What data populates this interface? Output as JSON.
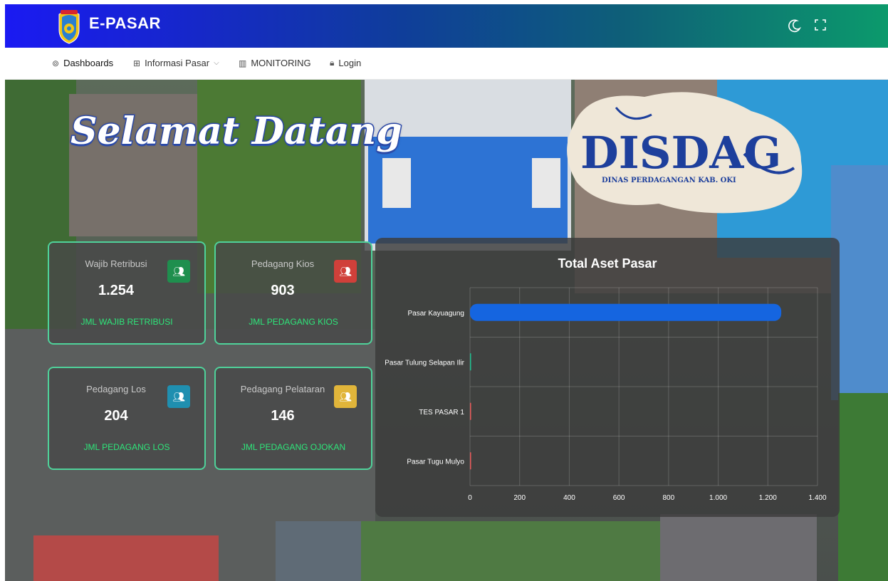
{
  "app": {
    "brand": "E-PASAR"
  },
  "nav": {
    "items": [
      {
        "label": "Dashboards",
        "icon": "dashboard-icon"
      },
      {
        "label": "Informasi Pasar",
        "icon": "grid-icon",
        "has_dropdown": true
      },
      {
        "label": "MONITORING",
        "icon": "bar-chart-icon"
      },
      {
        "label": "Login",
        "icon": "lock-icon"
      }
    ]
  },
  "topbar": {
    "theme_icon": "moon-icon",
    "fullscreen_icon": "fullscreen-icon"
  },
  "hero": {
    "welcome": "Selamat Datang",
    "logo_title": "DISDAG",
    "logo_subtitle": "DINAS PERDAGANGAN KAB. OKI"
  },
  "cards": [
    {
      "label": "Wajib Retribusi",
      "value": "1.254",
      "sub": "JML WAJIB RETRIBUSI",
      "icon": "users-icon",
      "accent": "#1f8f4e"
    },
    {
      "label": "Pedagang Kios",
      "value": "903",
      "sub": "JML PEDAGANG KIOS",
      "icon": "users-icon",
      "accent": "#d0403a"
    },
    {
      "label": "Pedagang Los",
      "value": "204",
      "sub": "JML PEDAGANG LOS",
      "icon": "users-icon",
      "accent": "#1f8fb0"
    },
    {
      "label": "Pedagang Pelataran",
      "value": "146",
      "sub": "JML PEDAGANG OJOKAN",
      "icon": "users-icon",
      "accent": "#e1b53a"
    }
  ],
  "chart_data": {
    "type": "bar",
    "orientation": "horizontal",
    "title": "Total Aset Pasar",
    "categories": [
      "Pasar Kayuagung",
      "Pasar Tulung Selapan Ilir",
      "TES PASAR 1",
      "Pasar Tugu Mulyo"
    ],
    "values": [
      1254,
      1,
      0,
      0
    ],
    "colors": [
      "#1565e0",
      "#1fbf8f",
      "#e85a5a",
      "#e85a5a"
    ],
    "xlim": [
      0,
      1400
    ],
    "xticks": [
      "0",
      "200",
      "400",
      "600",
      "800",
      "1.000",
      "1.200",
      "1.400"
    ],
    "grid": true
  }
}
